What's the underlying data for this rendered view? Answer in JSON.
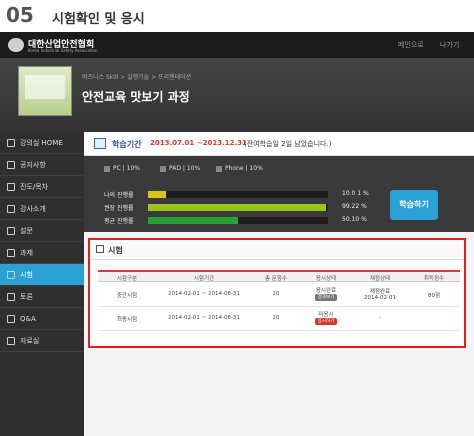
{
  "step": {
    "num": "05",
    "title": "시험확인 및 응시"
  },
  "header": {
    "logo_ko": "대한산업안전협회",
    "logo_en": "Korea Industrial Safety Association",
    "links": [
      "메인으로",
      "나가기"
    ]
  },
  "banner": {
    "breadcrumb": "비즈니스 Skill > 실행기술 > 프리젠테이션",
    "course_title": "안전교육 맛보기 과정"
  },
  "sidebar": {
    "items": [
      {
        "label": "강의실 HOME",
        "icon": "home-icon"
      },
      {
        "label": "공지사항",
        "icon": "notice-icon"
      },
      {
        "label": "진도/목차",
        "icon": "list-icon"
      },
      {
        "label": "강사소개",
        "icon": "person-icon"
      },
      {
        "label": "설문",
        "icon": "survey-icon"
      },
      {
        "label": "과제",
        "icon": "task-icon"
      },
      {
        "label": "시험",
        "icon": "exam-icon"
      },
      {
        "label": "토론",
        "icon": "discussion-icon"
      },
      {
        "label": "Q&A",
        "icon": "qa-icon"
      },
      {
        "label": "자료실",
        "icon": "folder-icon"
      }
    ],
    "active": "시험",
    "accent": "#2aa0d4"
  },
  "period": {
    "label": "학습기간",
    "dates": "2013.07.01 ~2013.12.31",
    "remain": "(잔여학습일 2일 남았습니다.)"
  },
  "devices": [
    {
      "name": "PC",
      "value": "10%"
    },
    {
      "name": "PAD",
      "value": "10%"
    },
    {
      "name": "Phone",
      "value": "10%"
    }
  ],
  "progress": [
    {
      "label": "나의 진행률",
      "value": "10.0 1 %",
      "fraction": 0.1,
      "color": "#d9c31a"
    },
    {
      "label": "권장 진행률",
      "value": "99.22 %",
      "fraction": 0.99,
      "color": "#9ac41a"
    },
    {
      "label": "평균 진행률",
      "value": "50.10 %",
      "fraction": 0.5,
      "color": "#2aa136"
    }
  ],
  "study_button": "학습하기",
  "exam": {
    "title": "시험",
    "columns": [
      "시험구분",
      "시험기간",
      "총 문항수",
      "응시상태",
      "채점상태",
      "취득점수"
    ],
    "rows": [
      {
        "type": "중간시험",
        "period": "2014-02-01 ~ 2014-08-31",
        "count": "20",
        "status": "응시완료",
        "action": "결과보기",
        "grading": "채점완료",
        "grading_date": "2014-02-01",
        "score": "80점"
      },
      {
        "type": "최종시험",
        "period": "2014-02-01 ~ 2014-08-31",
        "count": "20",
        "status": "미응시",
        "action": "응시하기",
        "grading": "-",
        "grading_date": "",
        "score": ""
      }
    ]
  }
}
